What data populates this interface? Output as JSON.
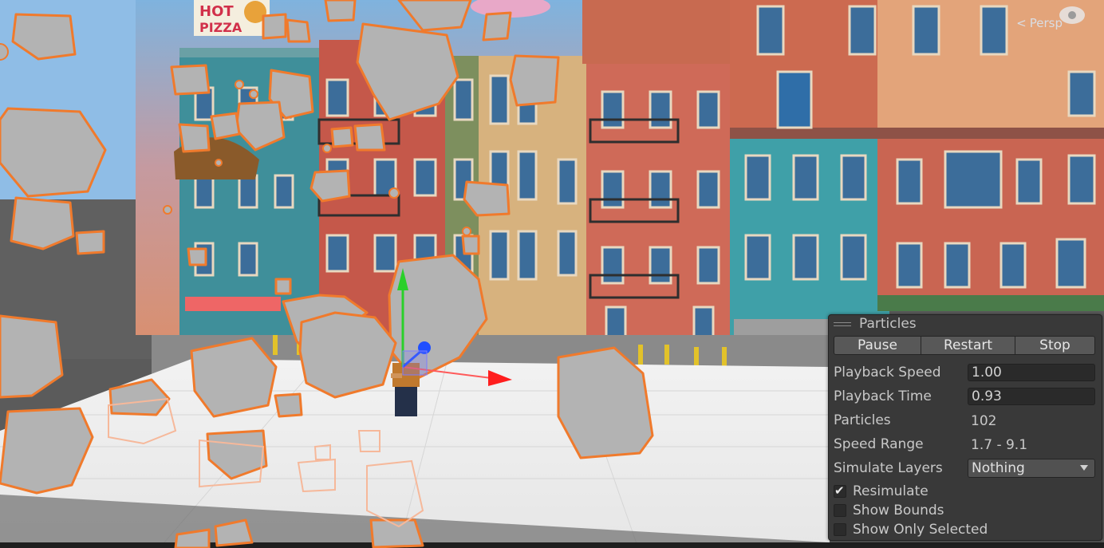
{
  "scene": {
    "view_label": "Persp",
    "sign_text": [
      "HOT",
      "PIZZA"
    ]
  },
  "icons": {
    "view_chevron": "chevron-left-icon",
    "camera_gizmo": "camera-icon",
    "panel_drag": "drag-handle-icon",
    "dropdown_arrow": "chevron-down-icon",
    "check": "checkmark-icon"
  },
  "colors": {
    "panel_bg": "#393939",
    "particle_fill": "#b3b3b3",
    "particle_outline": "#f07a2c",
    "gizmo_x": "#ff1e1e",
    "gizmo_y": "#2ad02a",
    "gizmo_z": "#1f4fff"
  },
  "panel": {
    "title": "Particles",
    "buttons": {
      "pause": "Pause",
      "restart": "Restart",
      "stop": "Stop"
    },
    "playback_speed": {
      "label": "Playback Speed",
      "value": "1.00"
    },
    "playback_time": {
      "label": "Playback Time",
      "value": "0.93"
    },
    "particles": {
      "label": "Particles",
      "value": "102"
    },
    "speed_range": {
      "label": "Speed Range",
      "value": "1.7 - 9.1"
    },
    "simulate_layers": {
      "label": "Simulate Layers",
      "value": "Nothing"
    },
    "resimulate": {
      "label": "Resimulate",
      "checked": true
    },
    "show_bounds": {
      "label": "Show Bounds",
      "checked": false
    },
    "show_only_selected": {
      "label": "Show Only Selected",
      "checked": false
    }
  }
}
